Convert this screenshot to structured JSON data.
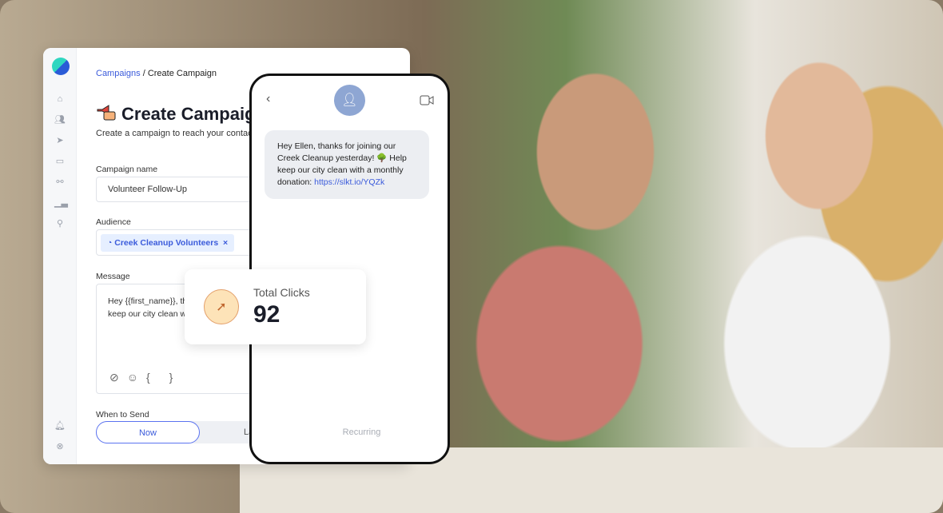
{
  "breadcrumb": {
    "parent": "Campaigns",
    "separator": "/",
    "current": "Create Campaign"
  },
  "page": {
    "title": "Create Campaign",
    "subtitle": "Create a campaign to reach your contacts"
  },
  "form": {
    "campaign_name_label": "Campaign name",
    "campaign_name_value": "Volunteer Follow-Up",
    "audience_label": "Audience",
    "audience_chip": "Creek Cleanup Volunteers",
    "chip_remove": "×",
    "message_label": "Message",
    "message_line1": "Hey {{first_name}}, th",
    "message_line2": "keep our city clean w",
    "variable_button": "{ }",
    "when_label": "When to Send",
    "when_options": [
      "Now",
      "Later",
      "Recurring"
    ],
    "when_selected": "Now"
  },
  "phone": {
    "message_text": "Hey Ellen, thanks for joining our Creek Cleanup yesterday! 🌳 Help keep our city clean with a monthly donation: ",
    "message_link": "https://slkt.io/YQZk"
  },
  "stats": {
    "label": "Total Clicks",
    "value": "92"
  },
  "colors": {
    "accent": "#3b5bdb",
    "avatar": "#8ea6d3",
    "clicks_icon_bg": "#fde3b8"
  }
}
